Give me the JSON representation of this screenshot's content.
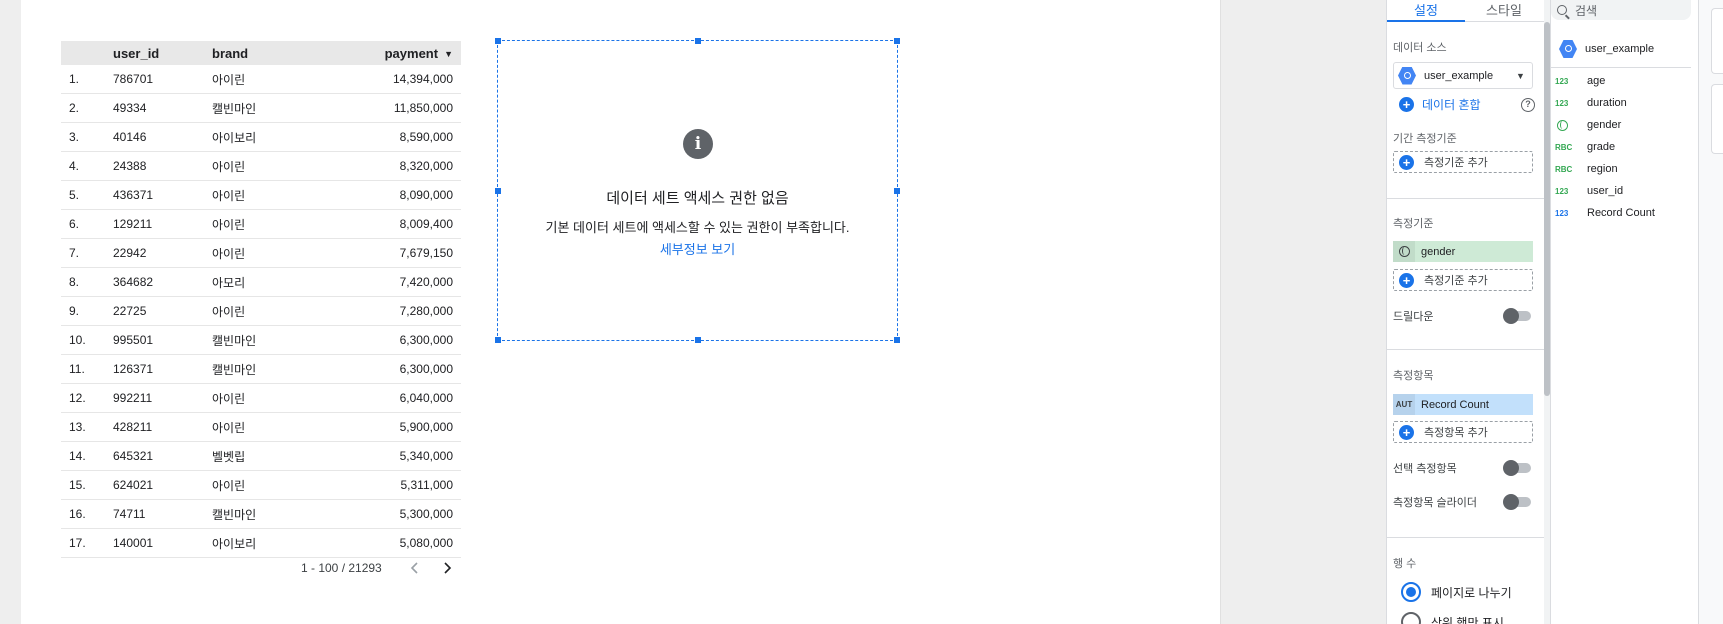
{
  "table": {
    "headers": {
      "user_id": "user_id",
      "brand": "brand",
      "payment": "payment"
    },
    "sort_caret": "▼",
    "rows": [
      {
        "idx": "1.",
        "user_id": "786701",
        "brand": "아이린",
        "payment": "14,394,000"
      },
      {
        "idx": "2.",
        "user_id": "49334",
        "brand": "캘빈마인",
        "payment": "11,850,000"
      },
      {
        "idx": "3.",
        "user_id": "40146",
        "brand": "아이보리",
        "payment": "8,590,000"
      },
      {
        "idx": "4.",
        "user_id": "24388",
        "brand": "아이린",
        "payment": "8,320,000"
      },
      {
        "idx": "5.",
        "user_id": "436371",
        "brand": "아이린",
        "payment": "8,090,000"
      },
      {
        "idx": "6.",
        "user_id": "129211",
        "brand": "아이린",
        "payment": "8,009,400"
      },
      {
        "idx": "7.",
        "user_id": "22942",
        "brand": "아이린",
        "payment": "7,679,150"
      },
      {
        "idx": "8.",
        "user_id": "364682",
        "brand": "아모리",
        "payment": "7,420,000"
      },
      {
        "idx": "9.",
        "user_id": "22725",
        "brand": "아이린",
        "payment": "7,280,000"
      },
      {
        "idx": "10.",
        "user_id": "995501",
        "brand": "캘빈마인",
        "payment": "6,300,000"
      },
      {
        "idx": "11.",
        "user_id": "126371",
        "brand": "캘빈마인",
        "payment": "6,300,000"
      },
      {
        "idx": "12.",
        "user_id": "992211",
        "brand": "아이린",
        "payment": "6,040,000"
      },
      {
        "idx": "13.",
        "user_id": "428211",
        "brand": "아이린",
        "payment": "5,900,000"
      },
      {
        "idx": "14.",
        "user_id": "645321",
        "brand": "벨벳립",
        "payment": "5,340,000"
      },
      {
        "idx": "15.",
        "user_id": "624021",
        "brand": "아이린",
        "payment": "5,311,000"
      },
      {
        "idx": "16.",
        "user_id": "74711",
        "brand": "캘빈마인",
        "payment": "5,300,000"
      },
      {
        "idx": "17.",
        "user_id": "140001",
        "brand": "아이보리",
        "payment": "5,080,000"
      }
    ],
    "pager_text": "1 - 100 / 21293",
    "prev_icon": "‹",
    "next_icon": "›"
  },
  "error_chart": {
    "icon": "i",
    "title": "데이터 세트 액세스 권한 없음",
    "description": "기본 데이터 세트에 액세스할 수 있는 권한이 부족합니다.",
    "link": "세부정보 보기"
  },
  "properties": {
    "tabs": {
      "setup": "설정",
      "style": "스타일"
    },
    "data_source_label": "데이터 소스",
    "data_source_value": "user_example",
    "blend_label": "데이터 혼합",
    "help": "?",
    "date_range_label": "기간 측정기준",
    "add_dimension": "측정기준 추가",
    "dimension_label": "측정기준",
    "dimension_chip": "gender",
    "drilldown_label": "드릴다운",
    "metric_label": "측정항목",
    "metric_chip_type": "AUT",
    "metric_chip": "Record Count",
    "add_metric": "측정항목 추가",
    "optional_metrics_label": "선택 측정항목",
    "metric_slider_label": "측정항목 슬라이더",
    "rows_label": "행 수",
    "paginate_label": "페이지로 나누기",
    "show_top_label": "상위 행만 표시"
  },
  "data_panel": {
    "search_placeholder": "검색",
    "source_name": "user_example",
    "fields": [
      {
        "type": "123",
        "name": "age",
        "kind": "dim"
      },
      {
        "type": "123",
        "name": "duration",
        "kind": "dim"
      },
      {
        "type": "globe",
        "name": "gender",
        "kind": "dim"
      },
      {
        "type": "RBC",
        "name": "grade",
        "kind": "dim"
      },
      {
        "type": "RBC",
        "name": "region",
        "kind": "dim"
      },
      {
        "type": "123",
        "name": "user_id",
        "kind": "dim"
      },
      {
        "type": "123",
        "name": "Record Count",
        "kind": "metric"
      }
    ]
  },
  "colors": {
    "accent": "#1a73e8",
    "dimension_chip": "#ceead6",
    "metric_chip": "#c2e0fb"
  }
}
